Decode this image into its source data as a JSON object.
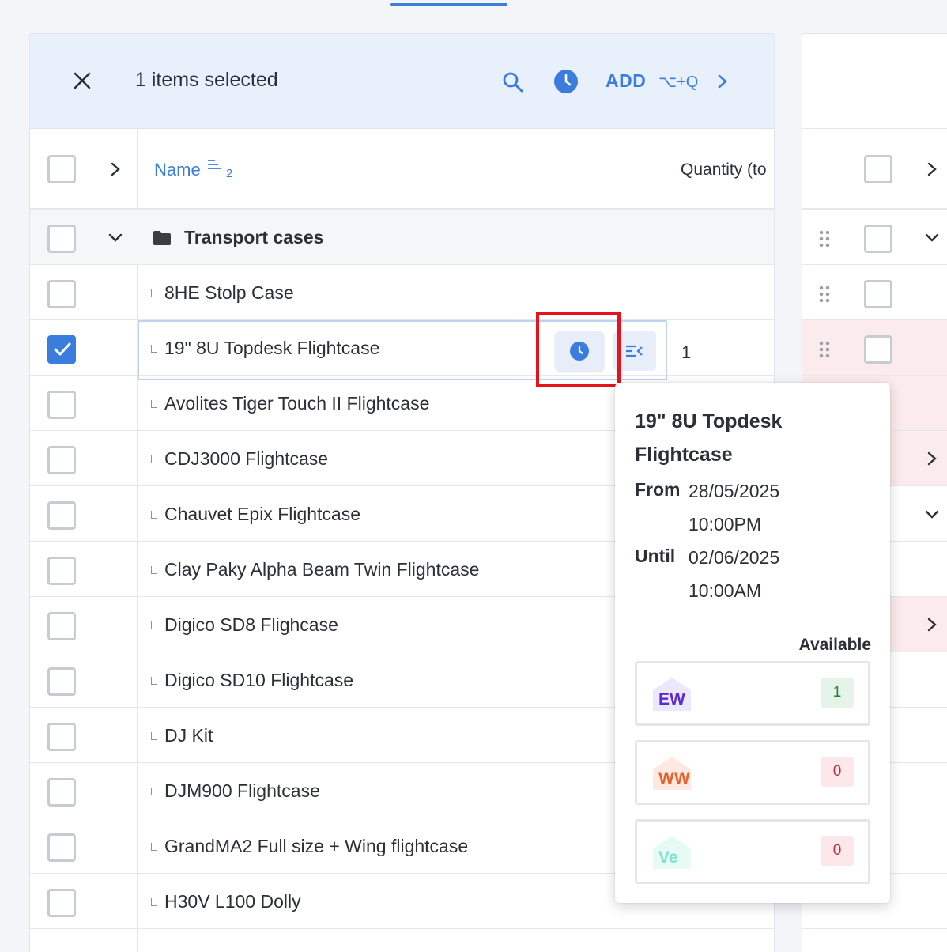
{
  "toolbar": {
    "selected_text": "1 items selected",
    "add_label": "ADD",
    "shortcut": "⌥+Q"
  },
  "header": {
    "name_col": "Name",
    "sort_index": "2",
    "quantity_col": "Quantity (to"
  },
  "group": {
    "label": "Transport cases"
  },
  "rows": [
    {
      "label": "8HE Stolp Case",
      "checked": false
    },
    {
      "label": "19\" 8U Topdesk Flightcase",
      "checked": true,
      "quantity": "1"
    },
    {
      "label": "Avolites Tiger Touch II Flightcase",
      "checked": false
    },
    {
      "label": "CDJ3000 Flightcase",
      "checked": false
    },
    {
      "label": "Chauvet Epix Flightcase",
      "checked": false
    },
    {
      "label": "Clay Paky Alpha Beam Twin Flightcase",
      "checked": false
    },
    {
      "label": "Digico SD8 Flighcase",
      "checked": false
    },
    {
      "label": "Digico SD10 Flightcase",
      "checked": false
    },
    {
      "label": "DJ Kit",
      "checked": false
    },
    {
      "label": "DJM900 Flightcase",
      "checked": false
    },
    {
      "label": "GrandMA2 Full size + Wing flightcase",
      "checked": false
    },
    {
      "label": "H30V L100 Dolly",
      "checked": false
    }
  ],
  "popover": {
    "title": "19\" 8U Topdesk Flightcase",
    "from_label": "From",
    "from_date": "28/05/2025",
    "from_time": "10:00PM",
    "until_label": "Until",
    "until_date": "02/06/2025",
    "until_time": "10:00AM",
    "available_label": "Available",
    "warehouses": [
      {
        "code": "EW",
        "count": "1",
        "color": "#5b2bd1",
        "house_color": "#ece8fb"
      },
      {
        "code": "WW",
        "count": "0",
        "color": "#e5612a",
        "house_color": "#fde9df"
      },
      {
        "code": "Ve",
        "count": "0",
        "color": "#7fe3cf",
        "house_color": "#e8faf6"
      }
    ]
  },
  "colors": {
    "accent": "#3b7ddd",
    "highlight": "#e8121a"
  }
}
